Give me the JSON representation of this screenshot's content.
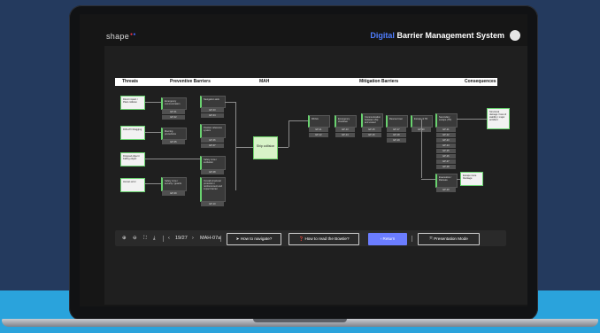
{
  "app": {
    "logo_text": "shape",
    "title_accent": "Digital",
    "title_rest": " Barrier Management System"
  },
  "columns": [
    "Threats",
    "Preventive Barriers",
    "MAH",
    "Mitigation Barriers",
    "Consequences"
  ],
  "threats": [
    "Direct impact / Plant collision",
    "Drift-off / Dragging",
    "Dropped object / Falling object",
    "Human error"
  ],
  "barriers_pre": [
    {
      "label": "Emergency communication",
      "cells": [
        "EP-01",
        "EP-02"
      ]
    },
    {
      "label": "Navigation aids",
      "cells": [
        "EP-03",
        "EP-04"
      ]
    },
    {
      "label": "Mooring procedures",
      "cells": [
        "EP-05"
      ]
    },
    {
      "label": "Position reference system",
      "cells": [
        "EP-06",
        "EP-07"
      ]
    },
    {
      "label": "Safety zone / exclusion",
      "cells": [
        "EP-08"
      ]
    },
    {
      "label": "Safety zone / security / guards",
      "cells": [
        "EP-09"
      ]
    },
    {
      "label": "Overall structural protection / reinforcement and impact barrier",
      "cells": [
        "EP-10"
      ]
    }
  ],
  "mah": {
    "label": "Ship collision"
  },
  "barriers_mit": [
    {
      "label": "PA/GA",
      "cells": [
        "EP-11",
        "EP-12"
      ]
    },
    {
      "label": "Emergency shutdown",
      "cells": [
        "EP-13",
        "EP-14"
      ]
    },
    {
      "label": "Communication between ship and vessel",
      "cells": [
        "EP-15",
        "EP-16"
      ]
    },
    {
      "label": "Rescue boat",
      "cells": [
        "EP-17",
        "EP-18",
        "EP-19"
      ]
    },
    {
      "label": "Escape & TR",
      "cells": [
        "EP-20"
      ]
    },
    {
      "label": "Secondary escape (TR)",
      "cells": [
        "EP-21",
        "EP-22",
        "EP-23",
        "EP-24",
        "EP-25",
        "EP-26",
        "EP-27",
        "EP-28"
      ]
    },
    {
      "label": "Evacuation / lifeboats",
      "cells": [
        "EP-29"
      ]
    }
  ],
  "consequences": [
    "Structural damage / loss of stability / major accident",
    "Escape route blockage"
  ],
  "toolbar": {
    "page_indicator": "19/27",
    "mah_code": "MAH-07a",
    "how_navigate": "How to navigate?",
    "how_read": "How to read the Bowtie?",
    "return": "Return",
    "presentation": "Presentation Mode"
  }
}
